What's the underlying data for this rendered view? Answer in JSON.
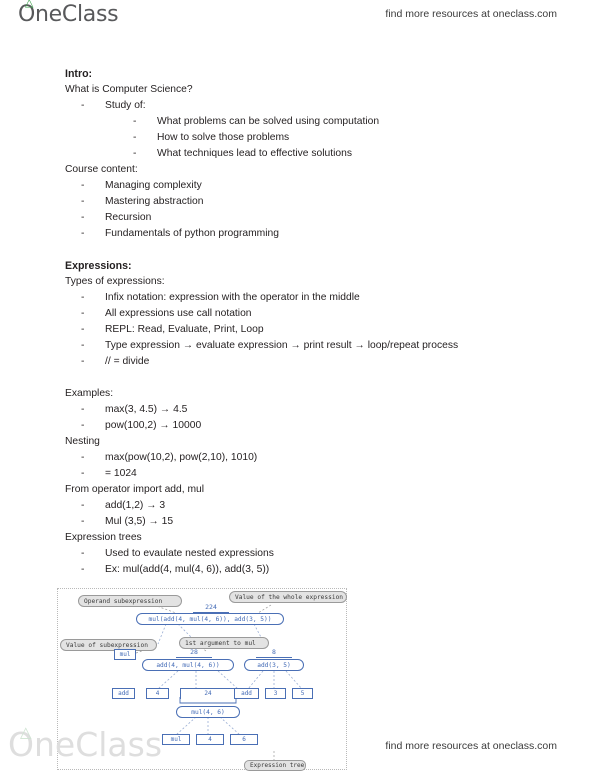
{
  "header": {
    "brand": "OneClass",
    "tagline": "find more resources at oneclass.com",
    "leaf_icon": "leaf-icon"
  },
  "footer": {
    "brand": "OneClass",
    "tagline": "find more resources at oneclass.com"
  },
  "notes": {
    "sections": [
      {
        "heading": "Intro:",
        "lines": [
          {
            "indent": 0,
            "dash": false,
            "text": "What is Computer Science?"
          },
          {
            "indent": 1,
            "dash": true,
            "text": "Study of:"
          },
          {
            "indent": 2,
            "dash": true,
            "text": "What problems can be solved using computation"
          },
          {
            "indent": 2,
            "dash": true,
            "text": "How to solve those problems"
          },
          {
            "indent": 2,
            "dash": true,
            "text": "What techniques lead to effective solutions"
          },
          {
            "indent": 0,
            "dash": false,
            "text": "Course content:"
          },
          {
            "indent": 1,
            "dash": true,
            "text": "Managing complexity"
          },
          {
            "indent": 1,
            "dash": true,
            "text": "Mastering abstraction"
          },
          {
            "indent": 1,
            "dash": true,
            "text": "Recursion"
          },
          {
            "indent": 1,
            "dash": true,
            "text": "Fundamentals of python programming"
          }
        ]
      },
      {
        "heading": "Expressions:",
        "lines": [
          {
            "indent": 0,
            "dash": false,
            "text": "Types of expressions:"
          },
          {
            "indent": 1,
            "dash": true,
            "text": "Infix notation: expression with the operator in the middle"
          },
          {
            "indent": 1,
            "dash": true,
            "text": "All expressions use call notation"
          },
          {
            "indent": 1,
            "dash": true,
            "text": "REPL: Read, Evaluate, Print, Loop"
          },
          {
            "indent": 1,
            "dash": true,
            "text": "Type expression → evaluate expression → print result → loop/repeat process"
          },
          {
            "indent": 1,
            "dash": true,
            "text": "// = divide"
          },
          {
            "indent": 0,
            "dash": false,
            "text": ""
          },
          {
            "indent": 0,
            "dash": false,
            "text": "Examples:"
          },
          {
            "indent": 1,
            "dash": true,
            "text": "max(3, 4.5) → 4.5"
          },
          {
            "indent": 1,
            "dash": true,
            "text": "pow(100,2) → 10000"
          },
          {
            "indent": 0,
            "dash": false,
            "text": "Nesting"
          },
          {
            "indent": 1,
            "dash": true,
            "text": "max(pow(10,2), pow(2,10), 1010)"
          },
          {
            "indent": 1,
            "dash": true,
            "text": "= 1024"
          },
          {
            "indent": 0,
            "dash": false,
            "text": "From operator import add, mul"
          },
          {
            "indent": 1,
            "dash": true,
            "text": "add(1,2) → 3"
          },
          {
            "indent": 1,
            "dash": true,
            "text": "Mul (3,5) → 15"
          },
          {
            "indent": 0,
            "dash": false,
            "text": "Expression trees"
          },
          {
            "indent": 1,
            "dash": true,
            "text": "Used to evaulate nested expressions"
          },
          {
            "indent": 1,
            "dash": true,
            "text": "Ex: mul(add(4, mul(4, 6)), add(3, 5))"
          }
        ]
      }
    ]
  },
  "diagram": {
    "title": "expression-tree-diagram",
    "accent_color": "#4a6fb5",
    "callout_bg": "#e3e3e3",
    "callouts": {
      "operand_subexpression": "Operand subexpression",
      "value_whole_expression": "Value of the whole expression",
      "value_subexpression": "Value of subexpression",
      "first_argument_to_mul": "1st argument to mul",
      "expression_tree": "Expression tree"
    },
    "nodes": {
      "root_value": "224",
      "root_expr": "mul(add(4, mul(4, 6)), add(3, 5))",
      "mul_operator_box": "mul",
      "left_value": "28",
      "left_expr": "add(4, mul(4, 6))",
      "right_value": "8",
      "right_expr": "add(3, 5)",
      "left_leaf_add": "add",
      "left_leaf_4": "4",
      "left_leaf_24": "24",
      "inner_expr": "mul(4, 6)",
      "inner_leaf_mul": "mul",
      "inner_leaf_4": "4",
      "inner_leaf_6": "6",
      "right_leaf_add": "add",
      "right_leaf_3": "3",
      "right_leaf_5": "5"
    }
  }
}
